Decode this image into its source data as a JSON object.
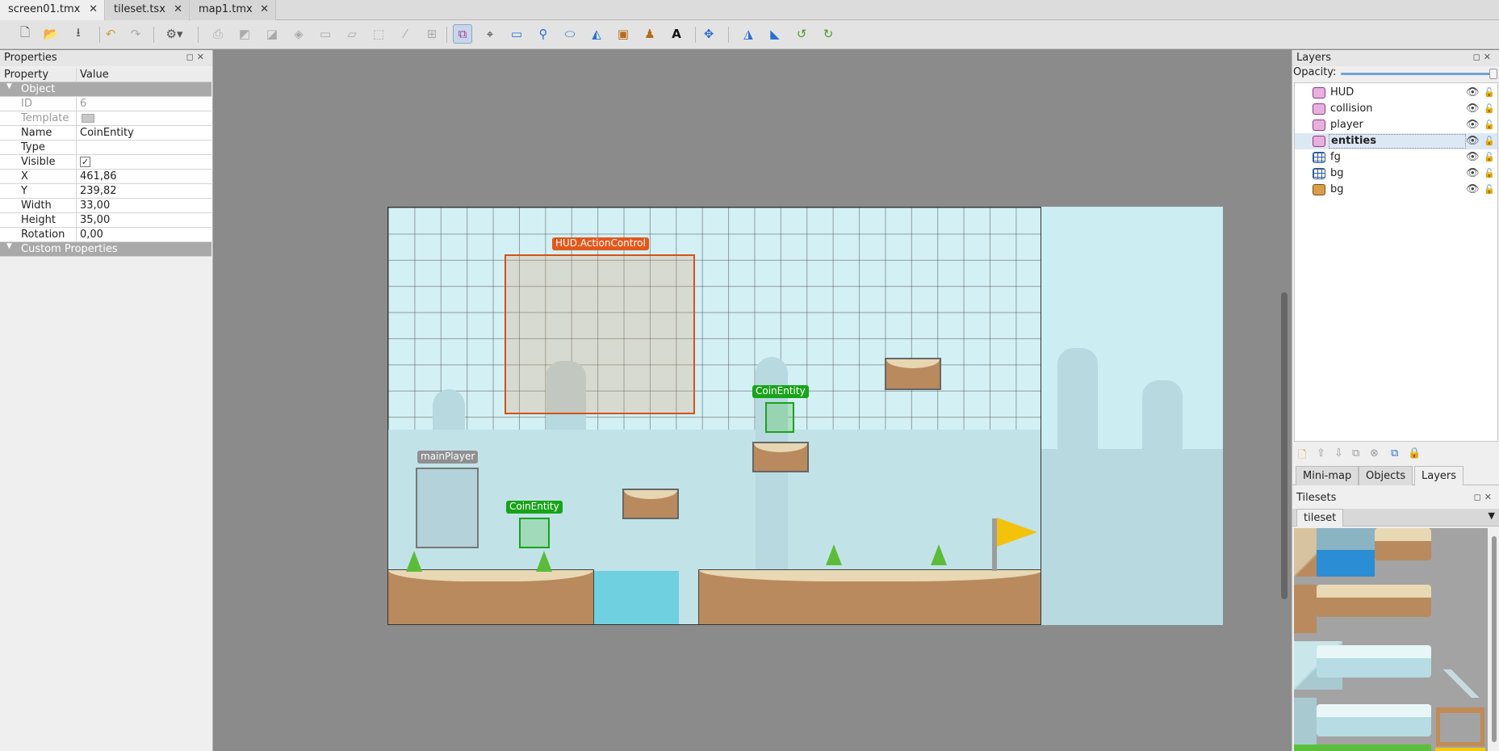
{
  "tabs": [
    {
      "label": "screen01.tmx",
      "active": true
    },
    {
      "label": "tileset.tsx",
      "active": false
    },
    {
      "label": "map1.tmx",
      "active": false
    }
  ],
  "toolbar": {
    "icons": [
      "new-file-icon",
      "open-file-icon",
      "save-file-icon",
      "undo-icon",
      "redo-icon",
      "commands-icon",
      "stamp-brush-icon",
      "terrain-brush-icon",
      "wang-brush-icon",
      "bucket-fill-icon",
      "shape-fill-icon",
      "eraser-icon",
      "rectangular-select-icon",
      "magic-wand-icon",
      "select-same-tile-icon",
      "select-objects-icon",
      "edit-polygons-icon",
      "insert-rectangle-icon",
      "insert-point-icon",
      "insert-ellipse-icon",
      "insert-polygon-icon",
      "insert-tile-icon",
      "insert-template-icon",
      "insert-text-icon",
      "random-mode-icon",
      "flip-horizontal-icon",
      "flip-vertical-icon",
      "rotate-left-icon",
      "rotate-right-icon"
    ]
  },
  "properties_panel": {
    "title": "Properties",
    "header": {
      "property": "Property",
      "value": "Value"
    },
    "object_group": "Object",
    "rows": [
      {
        "key": "ID",
        "value": "6",
        "dim": true
      },
      {
        "key": "Template",
        "value": "",
        "dim": true
      },
      {
        "key": "Name",
        "value": "CoinEntity"
      },
      {
        "key": "Type",
        "value": ""
      },
      {
        "key": "Visible",
        "value": "✓"
      },
      {
        "key": "X",
        "value": "461,86"
      },
      {
        "key": "Y",
        "value": "239,82"
      },
      {
        "key": "Width",
        "value": "33,00"
      },
      {
        "key": "Height",
        "value": "35,00"
      },
      {
        "key": "Rotation",
        "value": "0,00"
      }
    ],
    "custom_group": "Custom Properties"
  },
  "map": {
    "objects": [
      {
        "name": "HUD.ActionControl",
        "color": "#e4571c"
      },
      {
        "name": "CoinEntity",
        "color": "#19a319"
      },
      {
        "name": "CoinEntity",
        "color": "#19a319"
      },
      {
        "name": "mainPlayer",
        "color": "#8f8f8f"
      }
    ]
  },
  "layers_panel": {
    "title": "Layers",
    "opacity_label": "Opacity:",
    "opacity": 1.0,
    "layers": [
      {
        "name": "HUD",
        "kind": "object",
        "selected": false
      },
      {
        "name": "collision",
        "kind": "object",
        "selected": false
      },
      {
        "name": "player",
        "kind": "object",
        "selected": false
      },
      {
        "name": "entities",
        "kind": "object",
        "selected": true
      },
      {
        "name": "fg",
        "kind": "tile",
        "selected": false
      },
      {
        "name": "bg",
        "kind": "tile",
        "selected": false
      },
      {
        "name": "bg",
        "kind": "image",
        "selected": false
      }
    ]
  },
  "bottom_tabs": [
    {
      "label": "Mini-map",
      "active": false
    },
    {
      "label": "Objects",
      "active": false
    },
    {
      "label": "Layers",
      "active": true
    }
  ],
  "tilesets_panel": {
    "title": "Tilesets",
    "tileset_tab": "tileset"
  }
}
